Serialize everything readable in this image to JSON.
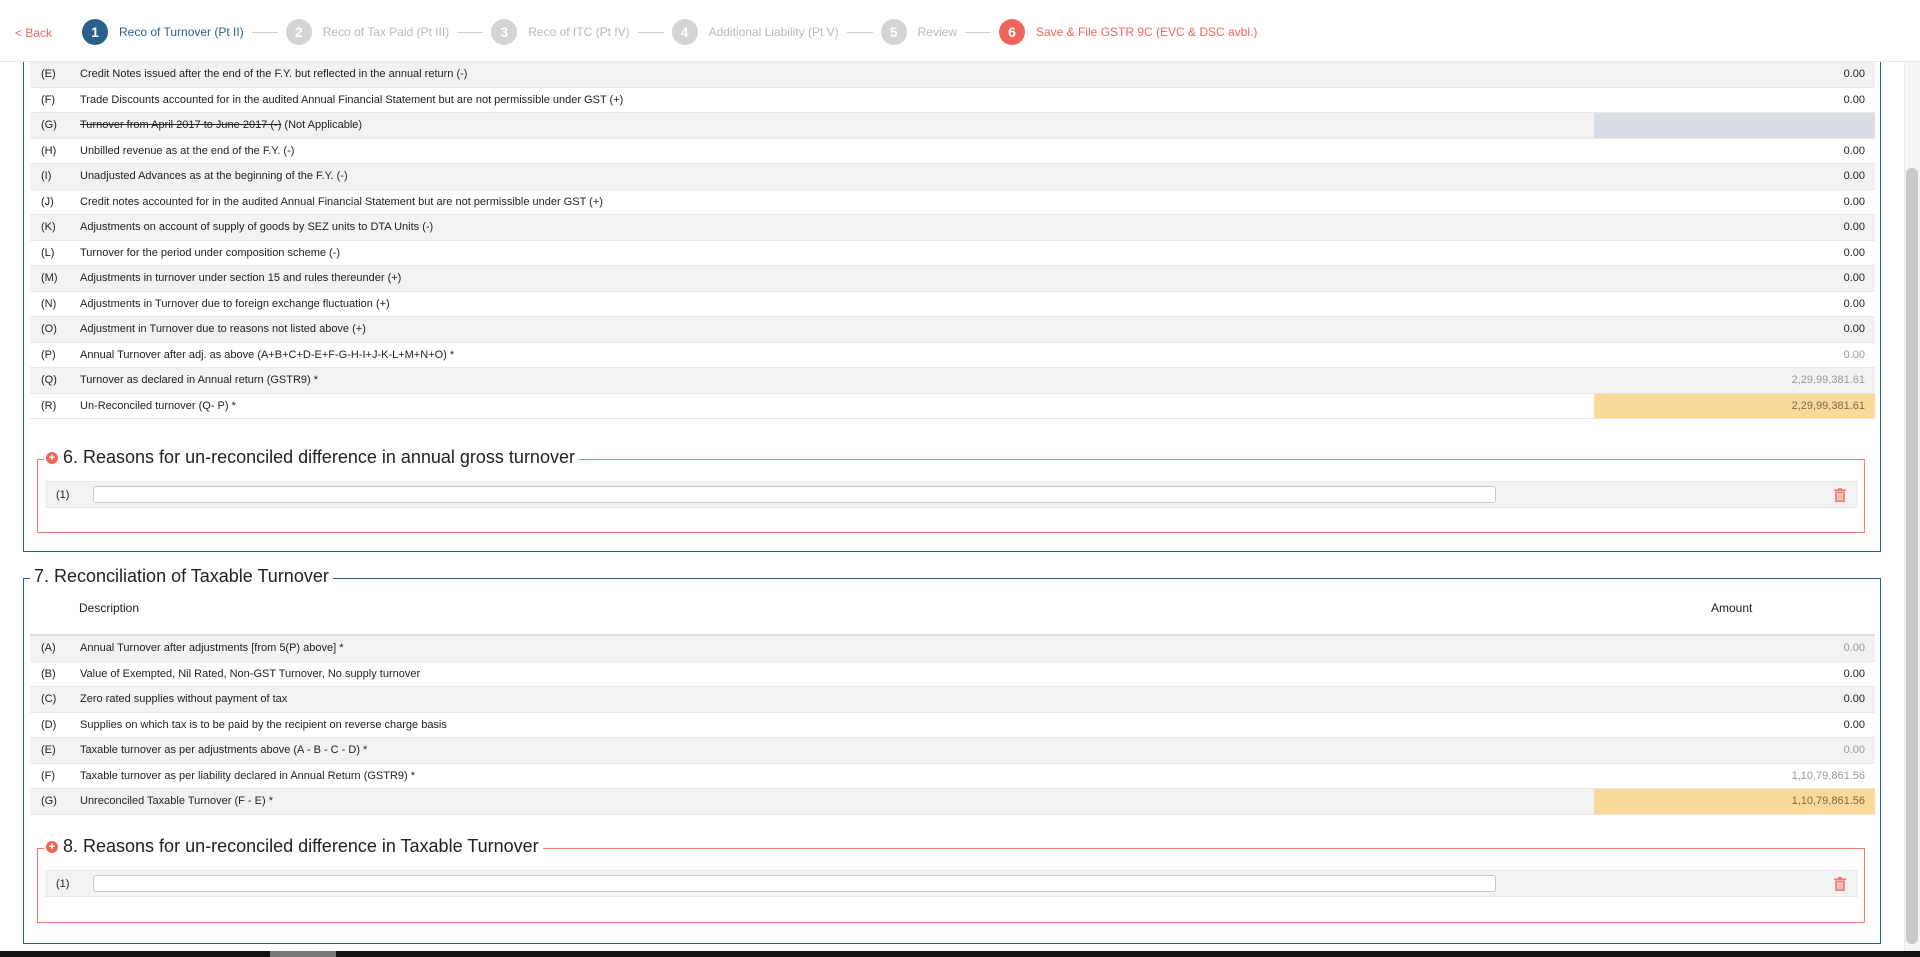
{
  "nav": {
    "back_label": "< Back",
    "steps": [
      {
        "num": "1",
        "label": "Reco of Turnover (Pt II)"
      },
      {
        "num": "2",
        "label": "Reco of Tax Paid (Pt III)"
      },
      {
        "num": "3",
        "label": "Reco of ITC (Pt IV)"
      },
      {
        "num": "4",
        "label": "Additional Liability (Pt V)"
      },
      {
        "num": "5",
        "label": "Review"
      },
      {
        "num": "6",
        "label": "Save & File GSTR 9C (EVC & DSC avbl.)"
      }
    ]
  },
  "section5": {
    "rows": [
      {
        "code": "(E)",
        "desc": "Credit Notes issued after the end of the F.Y. but reflected in the annual return (-)",
        "amount": "0.00"
      },
      {
        "code": "(F)",
        "desc": "Trade Discounts accounted for in the audited Annual Financial Statement but are not permissible under GST (+)",
        "amount": "0.00"
      },
      {
        "code": "(G)",
        "desc_strike": "Turnover from April 2017 to June 2017 (-)",
        "desc": " (Not Applicable)",
        "amount": ""
      },
      {
        "code": "(H)",
        "desc": "Unbilled revenue as at the end of the F.Y. (-)",
        "amount": "0.00"
      },
      {
        "code": "(I)",
        "desc": "Unadjusted Advances as at the beginning of the F.Y. (-)",
        "amount": "0.00"
      },
      {
        "code": "(J)",
        "desc": "Credit notes accounted for in the audited Annual Financial Statement but are not permissible under GST (+)",
        "amount": "0.00"
      },
      {
        "code": "(K)",
        "desc": "Adjustments on account of supply of goods by SEZ units to DTA Units (-)",
        "amount": "0.00"
      },
      {
        "code": "(L)",
        "desc": "Turnover for the period under composition scheme (-)",
        "amount": "0.00"
      },
      {
        "code": "(M)",
        "desc": "Adjustments in turnover under section 15 and rules thereunder (+)",
        "amount": "0.00"
      },
      {
        "code": "(N)",
        "desc": "Adjustments in Turnover due to foreign exchange fluctuation (+)",
        "amount": "0.00"
      },
      {
        "code": "(O)",
        "desc": "Adjustment in Turnover due to reasons not listed above (+)",
        "amount": "0.00"
      },
      {
        "code": "(P)",
        "desc": "Annual Turnover after adj. as above (A+B+C+D-E+F-G-H-I+J-K-L+M+N+O) *",
        "amount": "0.00"
      },
      {
        "code": "(Q)",
        "desc": "Turnover as declared in Annual return (GSTR9) *",
        "amount": "2,29,99,381.61"
      },
      {
        "code": "(R)",
        "desc": "Un-Reconciled turnover (Q- P) *",
        "amount": "2,29,99,381.61"
      }
    ]
  },
  "section6": {
    "title": "6. Reasons for un-reconciled difference in annual gross turnover",
    "plus": "+",
    "row_code": "(1)",
    "value": ""
  },
  "section7": {
    "title": "7. Reconciliation of Taxable Turnover",
    "header_desc": "Description",
    "header_amount": "Amount",
    "rows": [
      {
        "code": "(A)",
        "desc": "Annual Turnover after adjustments [from 5(P) above] *",
        "amount": "0.00"
      },
      {
        "code": "(B)",
        "desc": "Value of Exempted, Nil Rated, Non-GST Turnover, No supply turnover",
        "amount": "0.00"
      },
      {
        "code": "(C)",
        "desc": "Zero rated supplies without payment of tax",
        "amount": "0.00"
      },
      {
        "code": "(D)",
        "desc": "Supplies on which tax is to be paid by the recipient on reverse charge basis",
        "amount": "0.00"
      },
      {
        "code": "(E)",
        "desc": "Taxable turnover as per adjustments above (A - B - C - D) *",
        "amount": "0.00"
      },
      {
        "code": "(F)",
        "desc": "Taxable turnover as per liability declared in Annual Return (GSTR9) *",
        "amount": "1,10,79,861.56"
      },
      {
        "code": "(G)",
        "desc": "Unreconciled Taxable Turnover (F - E) *",
        "amount": "1,10,79,861.56"
      }
    ]
  },
  "section8": {
    "title": "8. Reasons for un-reconciled difference in Taxable Turnover",
    "plus": "+",
    "row_code": "(1)",
    "value": ""
  }
}
